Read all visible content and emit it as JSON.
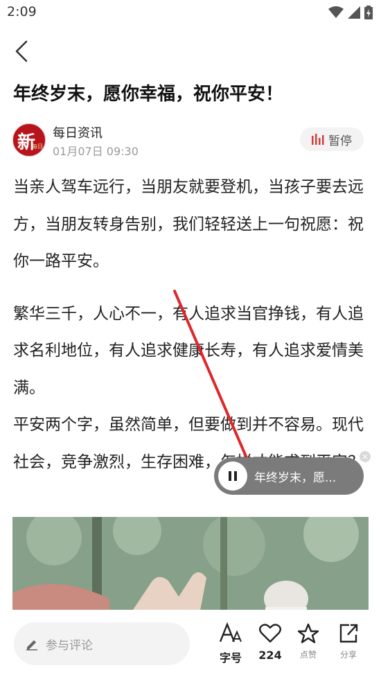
{
  "status_bar": {
    "time": "2:09"
  },
  "article": {
    "title": "年终岁末，愿你幸福，祝你平安！",
    "author": "每日资讯",
    "date": "01月07日 09:30",
    "avatar_text": "新",
    "avatar_subtext": "每日",
    "pause_label": "暂停",
    "paragraphs": [
      "当亲人驾车远行，当朋友就要登机，当孩子要去远方，当朋友转身告别，我们轻轻送上一句祝愿：祝你一路平安。",
      "繁华三千，人心不一，有人追求当官挣钱，有人追求名利地位，有人追求健康长寿，有人追求爱情美满。",
      "平安两个字，虽然简单，但要做到并不容易。现代社会，竞争激烈，生存困难，怎样才能求到平安？"
    ]
  },
  "floating_player": {
    "title": "年终岁末，愿..."
  },
  "bottom_bar": {
    "comment_placeholder": "参与评论",
    "font_label": "字号",
    "like_count": "224",
    "favorite_label": "点赞",
    "share_label": "分享"
  },
  "colors": {
    "accent_red": "#d23b3b",
    "avatar_red": "#b8141c",
    "gray_text": "#9a9a9a"
  },
  "icons": [
    "back-icon",
    "wifi-icon",
    "signal-icon",
    "battery-icon",
    "audio-bars-icon",
    "pause-icon",
    "close-icon",
    "pencil-icon",
    "font-size-icon",
    "heart-icon",
    "star-icon",
    "share-icon"
  ]
}
